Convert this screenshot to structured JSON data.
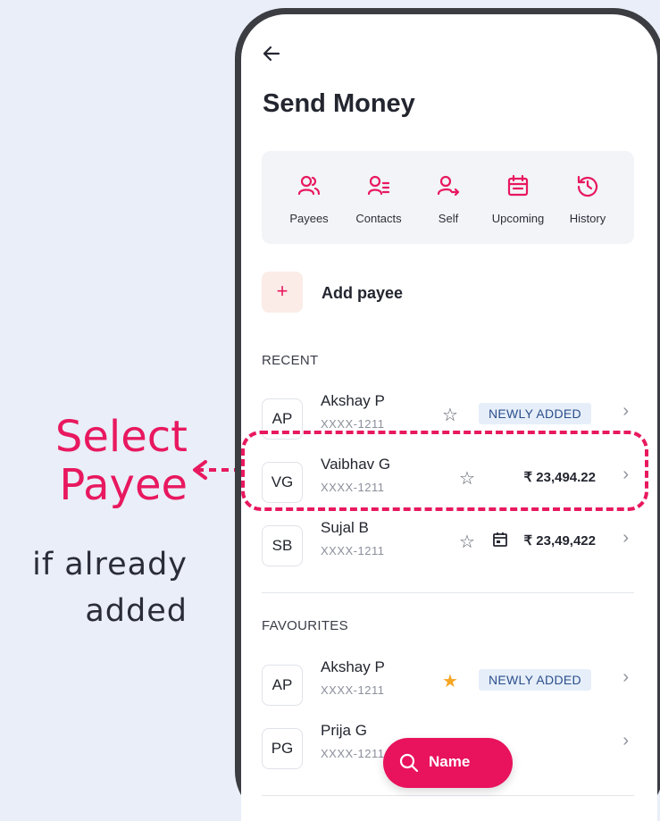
{
  "callout": {
    "title_line1": "Select",
    "title_line2": "Payee",
    "subtitle_line1": "if already",
    "subtitle_line2": "added"
  },
  "header": {
    "title": "Send Money",
    "back_icon": "arrow-left-icon"
  },
  "quick_actions": [
    {
      "label": "Payees",
      "icon": "payees-icon"
    },
    {
      "label": "Contacts",
      "icon": "contacts-icon"
    },
    {
      "label": "Self",
      "icon": "self-icon"
    },
    {
      "label": "Upcoming",
      "icon": "calendar-icon"
    },
    {
      "label": "History",
      "icon": "history-icon"
    }
  ],
  "add_payee": {
    "symbol": "+",
    "label": "Add payee"
  },
  "recent": {
    "heading": "RECENT",
    "items": [
      {
        "initials": "AP",
        "name": "Akshay P",
        "account": "XXXX-1211",
        "badge": "NEWLY ADDED",
        "favorite": false
      },
      {
        "initials": "VG",
        "name": "Vaibhav G",
        "account": "XXXX-1211",
        "amount": "₹ 23,494.22",
        "favorite": false
      },
      {
        "initials": "SB",
        "name": "Sujal B",
        "account": "XXXX-1211",
        "amount": "₹ 23,49,422",
        "favorite": false
      }
    ]
  },
  "favourites": {
    "heading": "FAVOURITES",
    "items": [
      {
        "initials": "AP",
        "name": "Akshay P",
        "account": "XXXX-1211",
        "badge": "NEWLY ADDED",
        "favorite": true
      },
      {
        "initials": "PG",
        "name": "Prija G",
        "account": "XXXX-1211",
        "favorite": true
      }
    ]
  },
  "fab": {
    "label": "Name",
    "icon": "search-icon"
  },
  "colors": {
    "accent": "#e8185f",
    "badge_bg": "#e6eef9",
    "badge_text": "#2b4f8c",
    "favorite_star": "#f5a623"
  }
}
